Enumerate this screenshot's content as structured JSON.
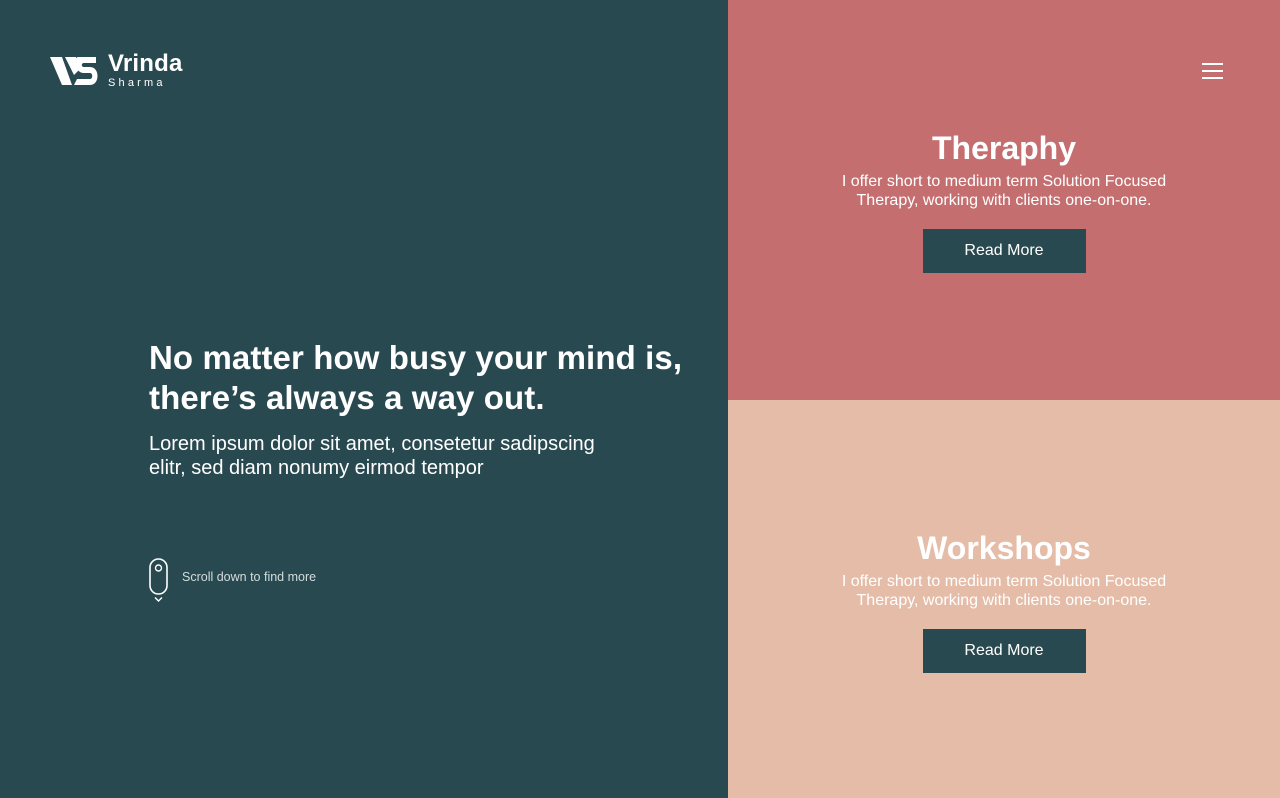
{
  "brand": {
    "name": "Vrinda",
    "subname": "Sharma",
    "logo_icon": "vs-monogram-icon"
  },
  "nav": {
    "menu_icon": "hamburger-menu-icon"
  },
  "hero": {
    "headline": "No matter how busy your mind is, there’s always a way out.",
    "body": "Lorem ipsum dolor sit amet, consetetur sadipscing elitr, sed diam nonumy eirmod tempor",
    "scroll_label": "Scroll down to find more",
    "scroll_icon": "mouse-scroll-icon"
  },
  "cards": [
    {
      "title": "Theraphy",
      "description": "I offer short to medium term Solution Focused Therapy, working with clients one-on-one.",
      "button": "Read More",
      "color": "#c46e70"
    },
    {
      "title": "Workshops",
      "description": "I offer short to medium term Solution Focused Therapy, working with clients one-on-one.",
      "button": "Read More",
      "color": "#e5bca7"
    }
  ],
  "colors": {
    "primary": "#294950",
    "therapy": "#c46e70",
    "workshops": "#e5bca7",
    "text": "#ffffff"
  }
}
